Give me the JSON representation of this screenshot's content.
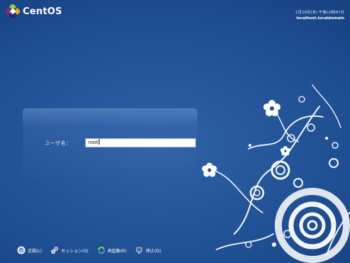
{
  "app": {
    "logo_text": "CentOS"
  },
  "clock": {
    "datetime": "1月19日(木) 午後10時47分",
    "hostname": "localhost.localdomain"
  },
  "login": {
    "username_label": "ユーザ名：",
    "username_value": "root"
  },
  "bottom_bar": {
    "items": [
      {
        "label": "言語(L)",
        "icon": "language-icon"
      },
      {
        "label": "セッション(S)",
        "icon": "session-icon"
      },
      {
        "label": "再起動(R)",
        "icon": "restart-icon"
      },
      {
        "label": "停止(D)",
        "icon": "shutdown-icon"
      }
    ]
  },
  "colors": {
    "background": "#1f4f93",
    "panel_highlight": "#78a0d7",
    "flower": "#ffffff"
  }
}
